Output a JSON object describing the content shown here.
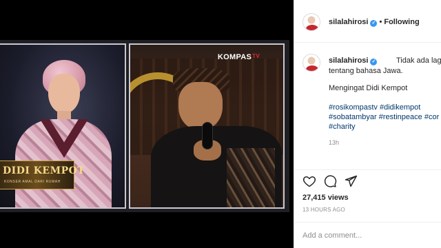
{
  "video": {
    "lower_third_title": "DIDI KEMPOT",
    "lower_third_subtitle": "KONSER AMAL DARI RUMAH",
    "tv_logo": "KOMPAS",
    "tv_logo_suffix": "TV"
  },
  "header": {
    "username": "silalahirosi",
    "separator": "•",
    "follow_state": "Following"
  },
  "caption": {
    "username": "silalahirosi",
    "line1": "Tidak ada lagi cand",
    "line2": "tentang bahasa Jawa.",
    "line3": "Mengingat Didi Kempot",
    "hashtags": [
      [
        "#rosikompastv",
        "#didikempot"
      ],
      [
        "#sobatambyar",
        "#restinpeace",
        "#cor"
      ],
      [
        "#charity"
      ]
    ],
    "time": "13h"
  },
  "actions": {
    "like_icon": "heart-icon",
    "comment_icon": "comment-icon",
    "share_icon": "paper-plane-icon"
  },
  "stats": {
    "views": "27,415 views",
    "posted_ago": "13 HOURS AGO"
  },
  "comment": {
    "placeholder": "Add a comment..."
  },
  "colors": {
    "link": "#00376b",
    "verified": "#3897f0",
    "muted": "#8e8e8e"
  }
}
